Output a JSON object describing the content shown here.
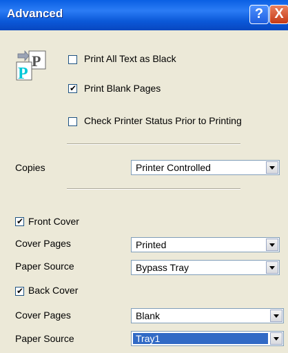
{
  "window": {
    "title": "Advanced"
  },
  "titlebar": {
    "help_label": "?",
    "close_label": "X"
  },
  "options": {
    "print_all_text_black": {
      "label": "Print All Text as Black",
      "checked": false
    },
    "print_blank_pages": {
      "label": "Print Blank Pages",
      "checked": true
    },
    "check_printer_status": {
      "label": "Check Printer Status Prior to Printing",
      "checked": false
    }
  },
  "copies": {
    "label": "Copies",
    "value": "Printer Controlled"
  },
  "front_cover": {
    "label": "Front Cover",
    "checked": true,
    "cover_pages_label": "Cover Pages",
    "cover_pages_value": "Printed",
    "paper_source_label": "Paper Source",
    "paper_source_value": "Bypass Tray"
  },
  "back_cover": {
    "label": "Back Cover",
    "checked": true,
    "cover_pages_label": "Cover Pages",
    "cover_pages_value": "Blank",
    "paper_source_label": "Paper Source",
    "paper_source_value": "Tray1"
  },
  "icons": {
    "printer_icon": "printer-settings-icon",
    "check_mark": "✔"
  },
  "colors": {
    "titlebar": "#0a5fe3",
    "selection": "#316ac5",
    "dialog_bg": "#ece9d8"
  }
}
